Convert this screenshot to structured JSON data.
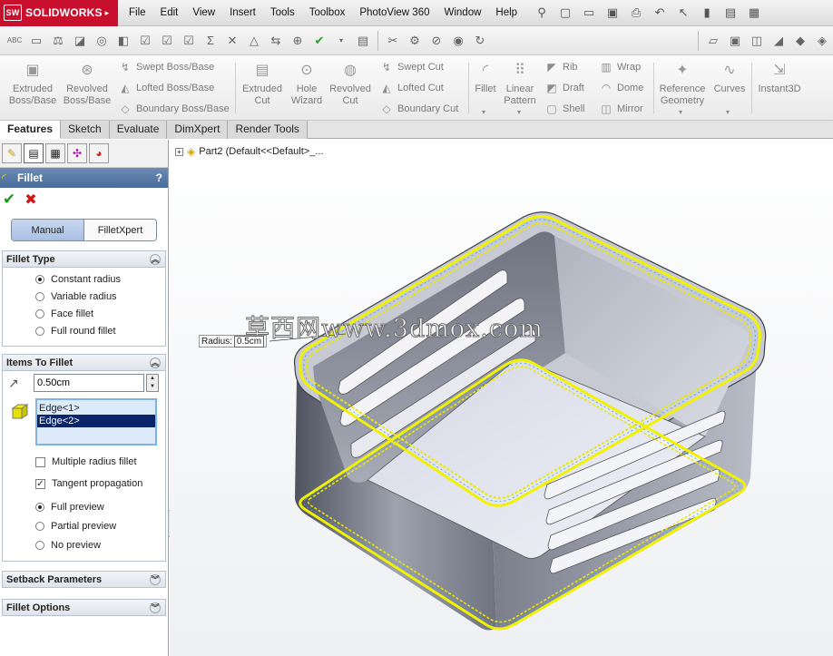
{
  "app": {
    "brand": "SOLIDWORKS",
    "brand_color": "#c8102e"
  },
  "menu": [
    "File",
    "Edit",
    "View",
    "Insert",
    "Tools",
    "Toolbox",
    "PhotoView 360",
    "Window",
    "Help"
  ],
  "commands": {
    "extruded_boss": "Extruded\nBoss/Base",
    "revolved_boss": "Revolved\nBoss/Base",
    "swept_boss": "Swept Boss/Base",
    "lofted_boss": "Lofted Boss/Base",
    "boundary_boss": "Boundary Boss/Base",
    "extruded_cut": "Extruded\nCut",
    "hole_wizard": "Hole\nWizard",
    "revolved_cut": "Revolved\nCut",
    "swept_cut": "Swept Cut",
    "lofted_cut": "Lofted Cut",
    "boundary_cut": "Boundary Cut",
    "fillet": "Fillet",
    "linear_pattern": "Linear\nPattern",
    "rib": "Rib",
    "draft": "Draft",
    "shell": "Shell",
    "wrap": "Wrap",
    "dome": "Dome",
    "mirror": "Mirror",
    "reference_geometry": "Reference\nGeometry",
    "curves": "Curves",
    "instant3d": "Instant3D"
  },
  "tabs": [
    {
      "label": "Features",
      "active": true
    },
    {
      "label": "Sketch"
    },
    {
      "label": "Evaluate"
    },
    {
      "label": "DimXpert"
    },
    {
      "label": "Render Tools"
    }
  ],
  "property_manager": {
    "title": "Fillet",
    "help": "?",
    "mode_manual": "Manual",
    "mode_xpert": "FilletXpert",
    "fillet_type": {
      "header": "Fillet Type",
      "options": [
        "Constant radius",
        "Variable radius",
        "Face fillet",
        "Full round fillet"
      ],
      "selected": 0
    },
    "items": {
      "header": "Items To Fillet",
      "radius": "0.50cm",
      "edges": [
        "Edge<1>",
        "Edge<2>"
      ],
      "selected_edge": 1,
      "multiple_radius": "Multiple radius fillet",
      "tangent_propagation": "Tangent propagation",
      "previews": [
        "Full preview",
        "Partial preview",
        "No preview"
      ],
      "preview_selected": 0
    },
    "setback_header": "Setback Parameters",
    "options_header": "Fillet Options"
  },
  "viewport": {
    "tree_label": "Part2  (Default<<Default>_...",
    "radius_label": "Radius:",
    "radius_value": "0.5cm",
    "watermark": "草西网www.3dmox.com",
    "highlight_color": "#f0f000"
  }
}
